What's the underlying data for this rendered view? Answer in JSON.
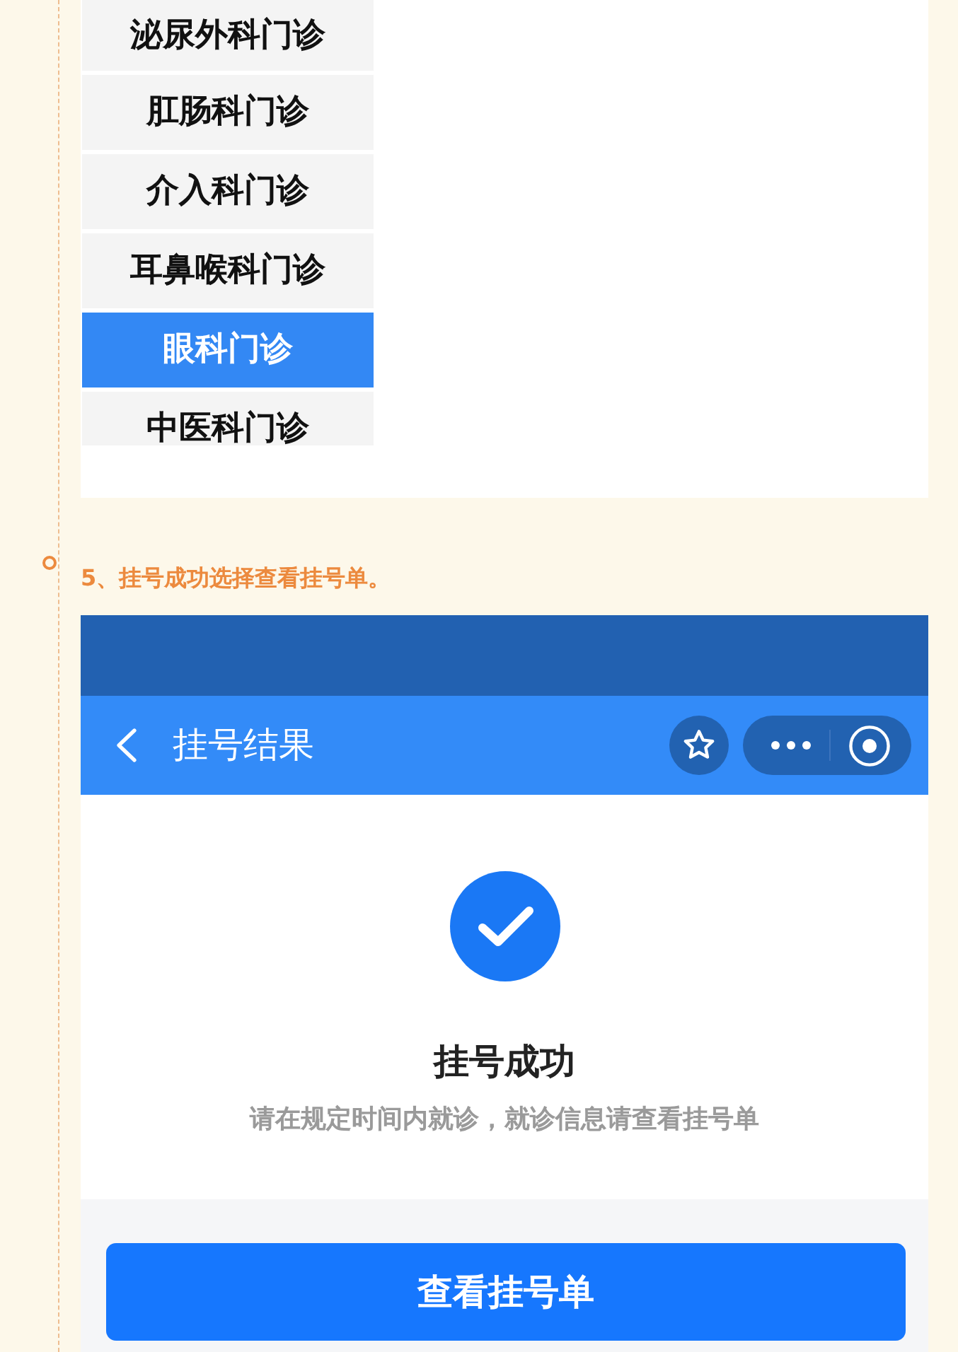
{
  "department_list": {
    "items": [
      {
        "label": "泌尿外科门诊",
        "selected": false
      },
      {
        "label": "肛肠科门诊",
        "selected": false
      },
      {
        "label": "介入科门诊",
        "selected": false
      },
      {
        "label": "耳鼻喉科门诊",
        "selected": false
      },
      {
        "label": "眼科门诊",
        "selected": true
      },
      {
        "label": "中医科门诊",
        "selected": false
      }
    ]
  },
  "step": {
    "text": "5、挂号成功选择查看挂号单。"
  },
  "app_screen": {
    "nav_bar": {
      "title": "挂号结果"
    },
    "result": {
      "title": "挂号成功",
      "message": "请在规定时间内就诊，就诊信息请查看挂号单"
    },
    "primary_button": {
      "label": "查看挂号单"
    }
  }
}
